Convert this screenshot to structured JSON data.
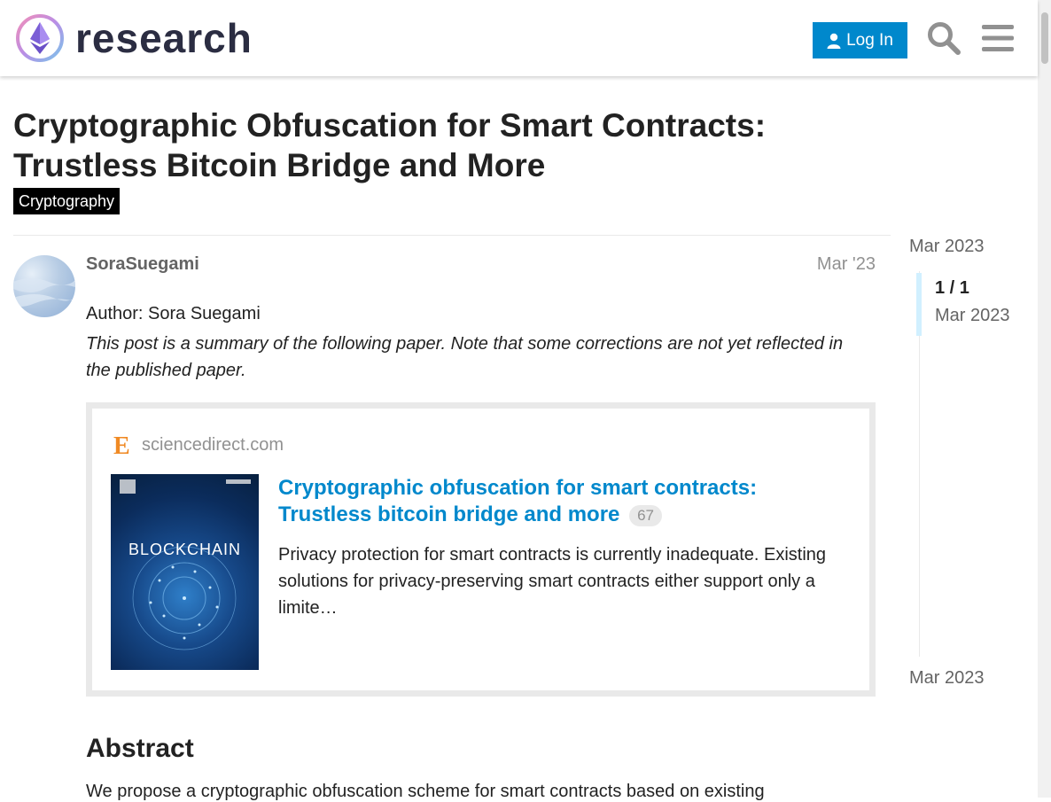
{
  "header": {
    "logo_text": "research",
    "login_label": "Log In"
  },
  "topic": {
    "title": "Cryptographic Obfuscation for Smart Contracts: Trustless Bitcoin Bridge and More",
    "category": "Cryptography"
  },
  "post": {
    "username": "SoraSuegami",
    "date": "Mar '23",
    "author_line": "Author: Sora Suegami",
    "summary": "This post is a summary of the following paper. Note that some corrections are not yet reflected in the published paper.",
    "onebox": {
      "domain": "sciencedirect.com",
      "thumb_title": "BLOCKCHAIN",
      "title": "Cryptographic obfuscation for smart contracts: Trustless bitcoin bridge and more",
      "click_count": "67",
      "description": "Privacy protection for smart contracts is currently inadequate. Existing solutions for privacy-preserving smart contracts either support only a limite…"
    },
    "abstract_heading": "Abstract",
    "abstract_text": "We propose a cryptographic obfuscation scheme for smart contracts based on existing"
  },
  "timeline": {
    "start_date": "Mar 2023",
    "position": "1 / 1",
    "position_date": "Mar 2023",
    "end_date": "Mar 2023"
  },
  "colors": {
    "accent": "#0088cc",
    "tag_bg": "#000000",
    "muted": "#919191"
  }
}
